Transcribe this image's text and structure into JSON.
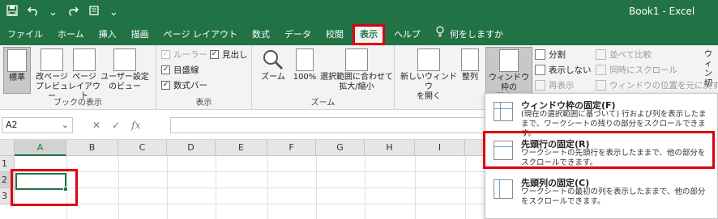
{
  "window": {
    "title": "Book1  -  Excel",
    "qat": {
      "save_icon": "save-icon",
      "undo_icon": "undo-icon",
      "undo_dd": "⌄",
      "customize": "⌄"
    }
  },
  "tabs": [
    "ファイル",
    "ホーム",
    "挿入",
    "描画",
    "ページ レイアウト",
    "数式",
    "データ",
    "校閲",
    "表示",
    "ヘルプ"
  ],
  "active_tab": "表示",
  "tell_me": "何をしますか",
  "ribbon": {
    "workbook_views": {
      "label": "ブックの表示",
      "buttons": [
        {
          "label": "標準"
        },
        {
          "label": "改ページ\nプレビュー"
        },
        {
          "label": "ページ\nレイアウト"
        },
        {
          "label": "ユーザー設定\nのビュー"
        }
      ]
    },
    "show": {
      "label": "表示",
      "checks": [
        {
          "label": "ルーラー",
          "checked": true,
          "disabled": true
        },
        {
          "label": "見出し",
          "checked": true,
          "disabled": false
        },
        {
          "label": "目盛線",
          "checked": true,
          "disabled": false
        },
        {
          "label": "数式バー",
          "checked": true,
          "disabled": false
        }
      ]
    },
    "zoom": {
      "label": "ズーム",
      "buttons": [
        {
          "label": "ズーム"
        },
        {
          "label": "100%"
        },
        {
          "label": "選択範囲に合わせて\n拡大/縮小"
        }
      ]
    },
    "window": {
      "buttons": [
        {
          "label": "新しいウィンドウ\nを開く"
        },
        {
          "label": "整列"
        },
        {
          "label": "ウィンドウ枠の\n固定 ⌄"
        }
      ],
      "small": [
        {
          "label": "分割",
          "disabled": false
        },
        {
          "label": "表示しない",
          "disabled": false
        },
        {
          "label": "再表示",
          "disabled": true
        }
      ],
      "right_small": [
        {
          "label": "並べて比較",
          "disabled": true
        },
        {
          "label": "同時にスクロール",
          "disabled": true
        },
        {
          "label": "ウィンドウの位置を元に戻す",
          "disabled": true
        }
      ],
      "cut_label": "ウィ\nン\n切"
    }
  },
  "formula_bar": {
    "name_box": "A2",
    "name_dd": "⌄",
    "cancel": "✕",
    "enter": "✓",
    "fx": "fx",
    "value": ""
  },
  "grid": {
    "columns": [
      "A",
      "B",
      "C",
      "D",
      "E",
      "F",
      "G",
      "H",
      "I"
    ],
    "rows": [
      "1",
      "2",
      "3"
    ],
    "active_cell": "A2"
  },
  "freeze_menu": {
    "items": [
      {
        "title": "ウィンドウ枠の固定(F)",
        "desc": "(現在の選択範囲に基づいて) 行および列を表示したままで、ワークシートの残りの部分をスクロールできます。"
      },
      {
        "title": "先頭行の固定(R)",
        "desc": "ワークシートの先頭行を表示したままで、他の部分をスクロールできます。"
      },
      {
        "title": "先頭列の固定(C)",
        "desc": "ワークシートの最初の列を表示したままで、他の部分をスクロールできます。"
      }
    ]
  },
  "colors": {
    "brand": "#217346",
    "highlight": "#e0000f"
  }
}
